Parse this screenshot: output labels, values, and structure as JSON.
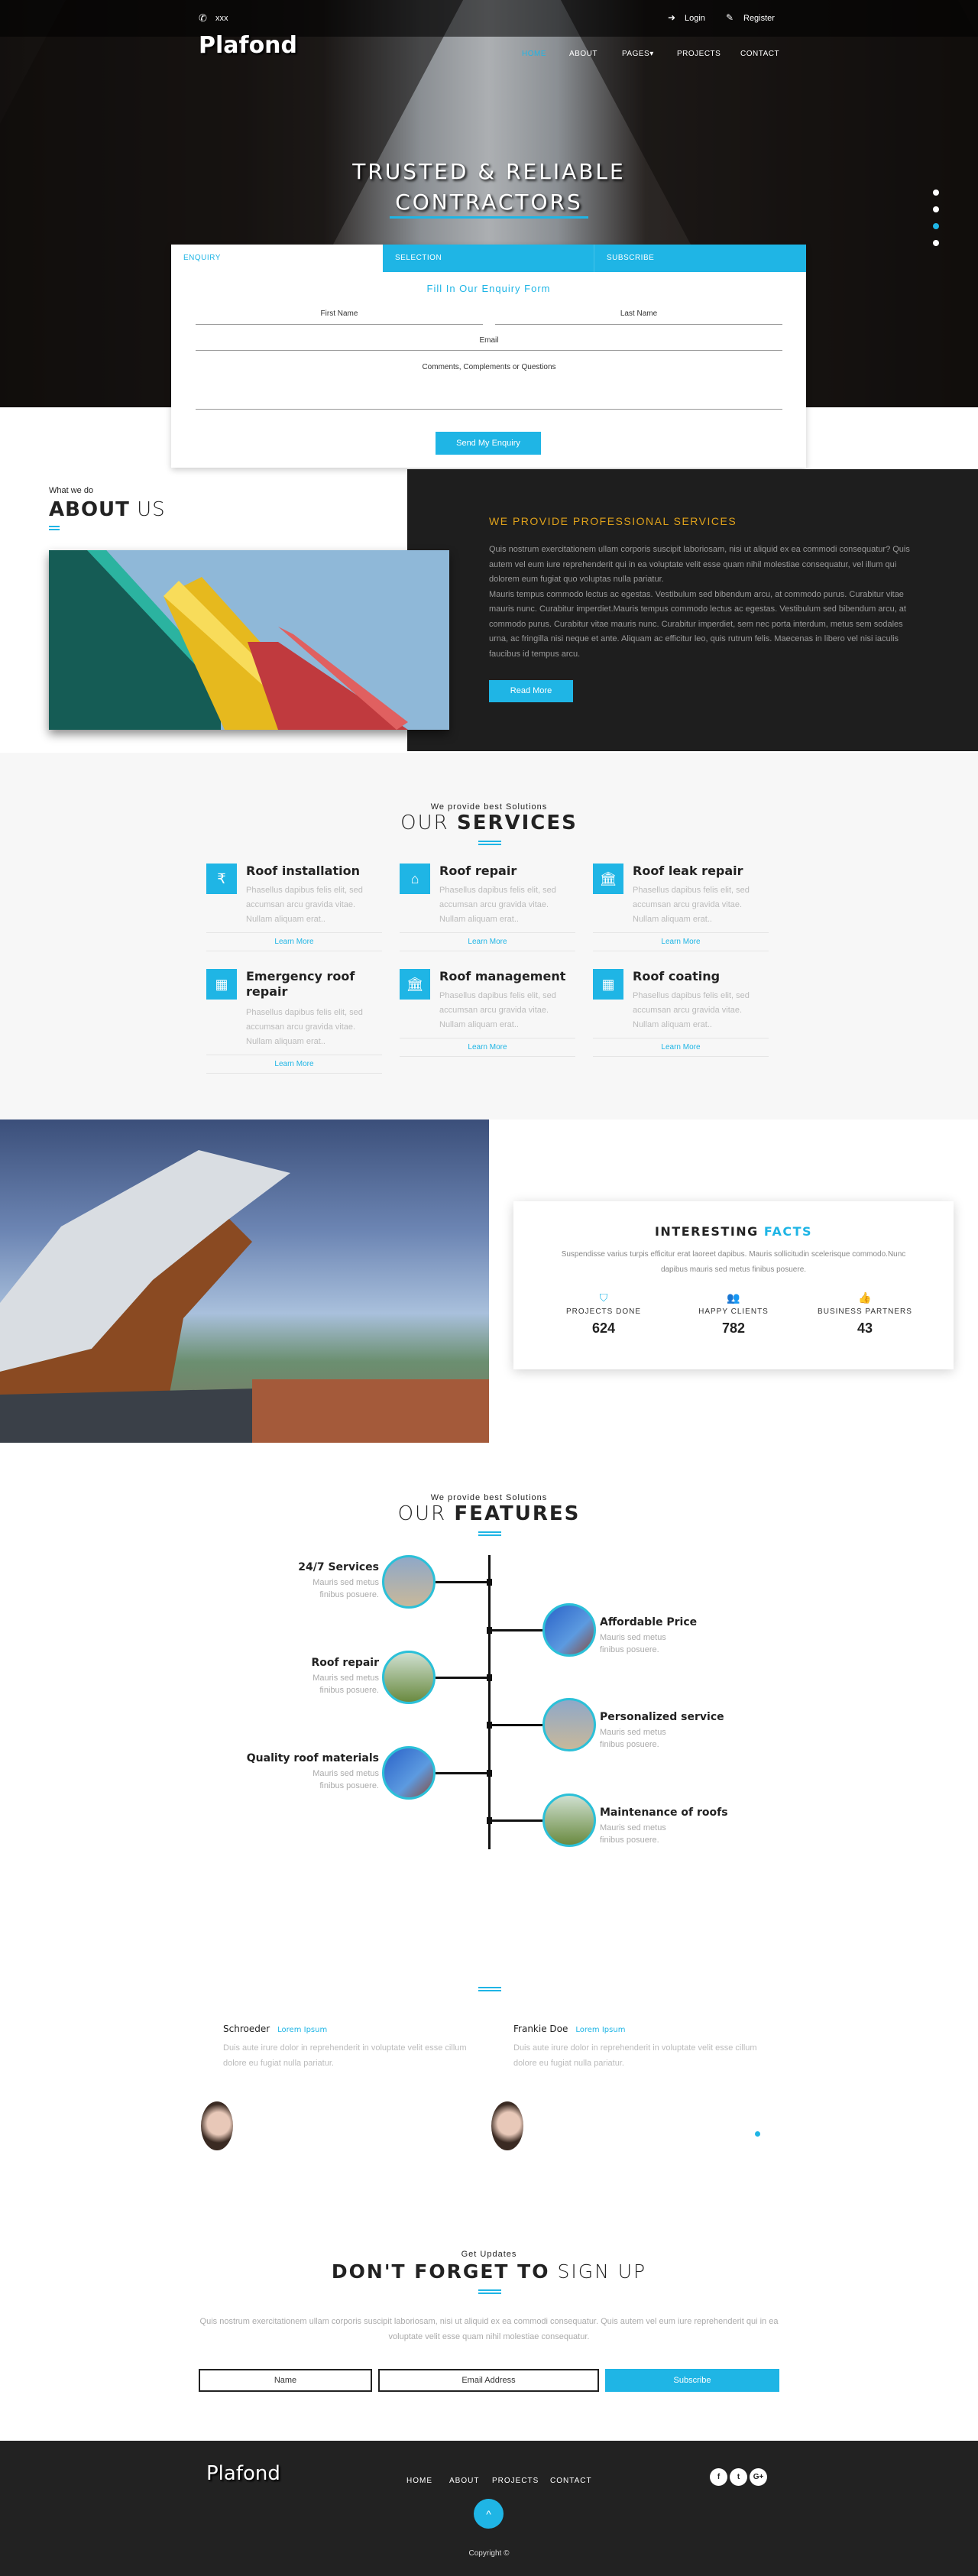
{
  "topbar": {
    "phone": "xxx",
    "login": "Login",
    "register": "Register"
  },
  "brand": "Plafond",
  "nav": [
    {
      "label": "HOME",
      "active": true
    },
    {
      "label": "ABOUT"
    },
    {
      "label": "PAGES▾"
    },
    {
      "label": "PROJECTS"
    },
    {
      "label": "CONTACT"
    }
  ],
  "hero": {
    "line1": "TRUSTED & RELIABLE",
    "line2": "CONTRACTORS",
    "slides": 4,
    "active_slide": 3
  },
  "enquiry": {
    "tabs": [
      "ENQUIRY",
      "SELECTION",
      "SUBSCRIBE"
    ],
    "heading": "Fill In Our Enquiry Form",
    "first_name": "First Name",
    "last_name": "Last Name",
    "email": "Email",
    "comments": "Comments, Complements or Questions",
    "submit": "Send My Enquiry"
  },
  "about": {
    "kicker": "What we do",
    "title_bold": "ABOUT",
    "title_thin": "US",
    "heading": "WE PROVIDE PROFESSIONAL SERVICES",
    "para1": "Quis nostrum exercitationem ullam corporis suscipit laboriosam, nisi ut aliquid ex ea commodi consequatur? Quis autem vel eum iure reprehenderit qui in ea voluptate velit esse quam nihil molestiae consequatur, vel illum qui dolorem eum fugiat quo voluptas nulla pariatur.",
    "para2": "Mauris tempus commodo lectus ac egestas. Vestibulum sed bibendum arcu, at commodo purus. Curabitur vitae mauris nunc. Curabitur imperdiet.Mauris tempus commodo lectus ac egestas. Vestibulum sed bibendum arcu, at commodo purus. Curabitur vitae mauris nunc. Curabitur imperdiet, sem nec porta interdum, metus sem sodales urna, ac fringilla nisi neque et ante. Aliquam ac efficitur leo, quis rutrum felis. Maecenas in libero vel nisi iaculis faucibus id tempus arcu.",
    "button": "Read More"
  },
  "services": {
    "kicker": "We provide best Solutions",
    "title_thin": "OUR",
    "title_bold": "SERVICES",
    "items": [
      {
        "title": "Roof installation",
        "icon": "rupee-icon",
        "desc": "Phasellus dapibus felis elit, sed accumsan arcu gravida vitae. Nullam aliquam erat..",
        "link": "Learn More"
      },
      {
        "title": "Roof repair",
        "icon": "home-icon",
        "desc": "Phasellus dapibus felis elit, sed accumsan arcu gravida vitae. Nullam aliquam erat..",
        "link": "Learn More"
      },
      {
        "title": "Roof leak repair",
        "icon": "bank-icon",
        "desc": "Phasellus dapibus felis elit, sed accumsan arcu gravida vitae. Nullam aliquam erat..",
        "link": "Learn More"
      },
      {
        "title": "Emergency roof repair",
        "icon": "building-icon",
        "desc": "Phasellus dapibus felis elit, sed accumsan arcu gravida vitae. Nullam aliquam erat..",
        "link": "Learn More"
      },
      {
        "title": "Roof management",
        "icon": "bank-icon",
        "desc": "Phasellus dapibus felis elit, sed accumsan arcu gravida vitae. Nullam aliquam erat..",
        "link": "Learn More"
      },
      {
        "title": "Roof coating",
        "icon": "building-icon",
        "desc": "Phasellus dapibus felis elit, sed accumsan arcu gravida vitae. Nullam aliquam erat..",
        "link": "Learn More"
      }
    ]
  },
  "facts": {
    "title_dark": "INTERESTING",
    "title_blue": "FACTS",
    "desc": "Suspendisse varius turpis efficitur erat laoreet dapibus. Mauris sollicitudin scelerisque commodo.Nunc dapibus mauris sed metus finibus posuere.",
    "stats": [
      {
        "label": "PROJECTS DONE",
        "value": "624",
        "icon": "shield-icon"
      },
      {
        "label": "HAPPY CLIENTS",
        "value": "782",
        "icon": "users-icon"
      },
      {
        "label": "BUSINESS PARTNERS",
        "value": "43",
        "icon": "thumbs-up-icon"
      }
    ]
  },
  "features": {
    "kicker": "We provide best Solutions",
    "title_thin": "OUR",
    "title_bold": "FEATURES",
    "left": [
      {
        "title": "24/7 Services",
        "desc": "Mauris sed metus finibus posuere."
      },
      {
        "title": "Roof repair",
        "desc": "Mauris sed metus finibus posuere."
      },
      {
        "title": "Quality roof materials",
        "desc": "Mauris sed metus finibus posuere."
      }
    ],
    "right": [
      {
        "title": "Affordable Price",
        "desc": "Mauris sed metus finibus posuere."
      },
      {
        "title": "Personalized service",
        "desc": "Mauris sed metus finibus posuere."
      },
      {
        "title": "Maintenance of roofs",
        "desc": "Mauris sed metus finibus posuere."
      }
    ]
  },
  "testimonials": [
    {
      "name": "Schroeder",
      "tag": "Lorem Ipsum",
      "text": "Duis aute irure dolor in reprehenderit in voluptate velit esse cillum dolore eu fugiat nulla pariatur."
    },
    {
      "name": "Frankie Doe",
      "tag": "Lorem Ipsum",
      "text": "Duis aute irure dolor in reprehenderit in voluptate velit esse cillum dolore eu fugiat nulla pariatur."
    }
  ],
  "signup": {
    "kicker": "Get Updates",
    "title_bold": "DON'T FORGET TO",
    "title_thin": "SIGN UP",
    "desc": "Quis nostrum exercitationem ullam corporis suscipit laboriosam, nisi ut aliquid ex ea commodi consequatur. Quis autem vel eum iure reprehenderit qui in ea voluptate velit esse quam nihil molestiae consequatur.",
    "name_placeholder": "Name",
    "email_placeholder": "Email Address",
    "button": "Subscribe"
  },
  "footer": {
    "brand": "Plafond",
    "nav": [
      "HOME",
      "ABOUT",
      "PROJECTS",
      "CONTACT"
    ],
    "social": [
      "f",
      "t",
      "G+"
    ],
    "copyright": "Copyright ©"
  },
  "colors": {
    "accent": "#1fb5e5",
    "gold": "#e0a21b",
    "dark": "#1e1e1e"
  }
}
